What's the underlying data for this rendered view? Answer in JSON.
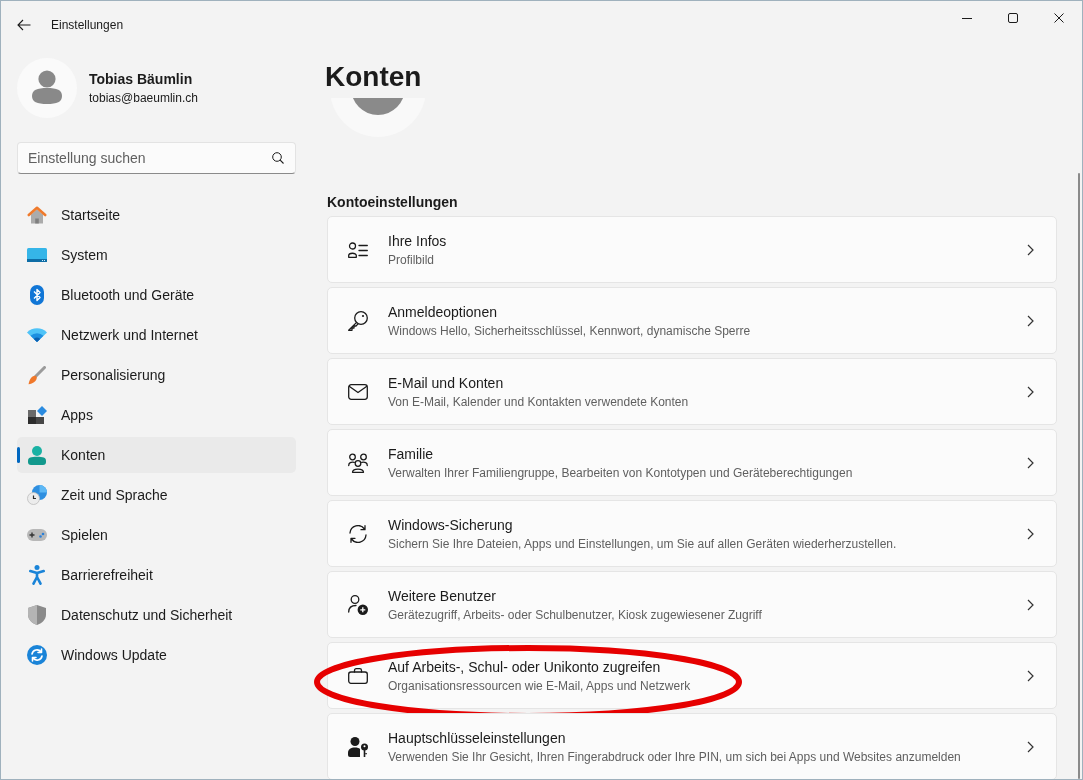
{
  "window": {
    "title": "Einstellungen"
  },
  "account": {
    "name": "Tobias Bäumlin",
    "email": "tobias@baeumlin.ch"
  },
  "search": {
    "placeholder": "Einstellung suchen"
  },
  "sidebar": {
    "items": [
      {
        "label": "Startseite",
        "selected": false
      },
      {
        "label": "System",
        "selected": false
      },
      {
        "label": "Bluetooth und Geräte",
        "selected": false
      },
      {
        "label": "Netzwerk und Internet",
        "selected": false
      },
      {
        "label": "Personalisierung",
        "selected": false
      },
      {
        "label": "Apps",
        "selected": false
      },
      {
        "label": "Konten",
        "selected": true
      },
      {
        "label": "Zeit und Sprache",
        "selected": false
      },
      {
        "label": "Spielen",
        "selected": false
      },
      {
        "label": "Barrierefreiheit",
        "selected": false
      },
      {
        "label": "Datenschutz und Sicherheit",
        "selected": false
      },
      {
        "label": "Windows Update",
        "selected": false
      }
    ]
  },
  "page": {
    "title": "Konten",
    "section": "Kontoeinstellungen",
    "cards": [
      {
        "title": "Ihre Infos",
        "subtitle": "Profilbild",
        "highlighted": false
      },
      {
        "title": "Anmeldeoptionen",
        "subtitle": "Windows Hello, Sicherheitsschlüssel, Kennwort, dynamische Sperre",
        "highlighted": false
      },
      {
        "title": "E-Mail und Konten",
        "subtitle": "Von E-Mail, Kalender und Kontakten verwendete Konten",
        "highlighted": false
      },
      {
        "title": "Familie",
        "subtitle": "Verwalten Ihrer Familiengruppe, Bearbeiten von Kontotypen und Geräteberechtigungen",
        "highlighted": false
      },
      {
        "title": "Windows-Sicherung",
        "subtitle": "Sichern Sie Ihre Dateien, Apps und Einstellungen, um Sie auf allen Geräten wiederherzustellen.",
        "highlighted": false
      },
      {
        "title": "Weitere Benutzer",
        "subtitle": "Gerätezugriff, Arbeits- oder Schulbenutzer, Kiosk zugewiesener Zugriff",
        "highlighted": false
      },
      {
        "title": "Auf Arbeits-, Schul- oder Unikonto zugreifen",
        "subtitle": "Organisationsressourcen wie E-Mail, Apps und Netzwerk",
        "highlighted": true
      },
      {
        "title": "Hauptschlüsseleinstellungen",
        "subtitle": "Verwenden Sie Ihr Gesicht, Ihren Fingerabdruck oder Ihre PIN, um sich bei Apps und Websites anzumelden",
        "highlighted": false
      }
    ]
  }
}
